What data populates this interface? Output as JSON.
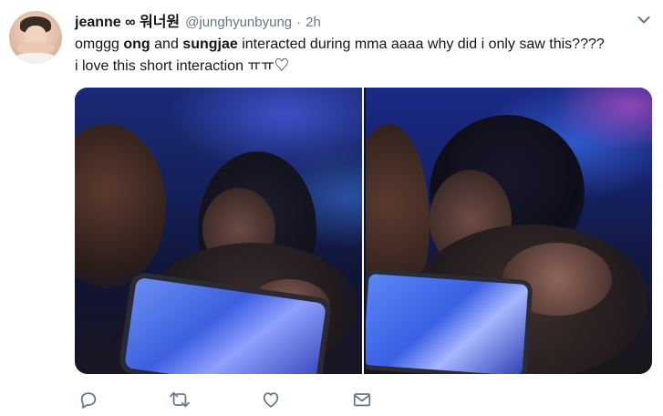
{
  "tweet": {
    "display_name": "jeanne ∞ 워너원",
    "handle": "@junghyunbyung",
    "separator": "·",
    "timestamp": "2h",
    "text": {
      "line1_part1": "omggg ",
      "line1_bold1": "ong",
      "line1_part2": " and ",
      "line1_bold2": "sungjae",
      "line1_part3": " interacted during mma aaaa why did i only saw this????",
      "line2": "i love this short interaction ㅠㅠ♡"
    },
    "media_count": 2
  },
  "actions": {
    "reply_icon": "reply-icon",
    "retweet_icon": "retweet-icon",
    "like_icon": "heart-icon",
    "dm_icon": "envelope-icon"
  },
  "colors": {
    "text": "#14171a",
    "secondary": "#657786",
    "icon": "#657786"
  }
}
